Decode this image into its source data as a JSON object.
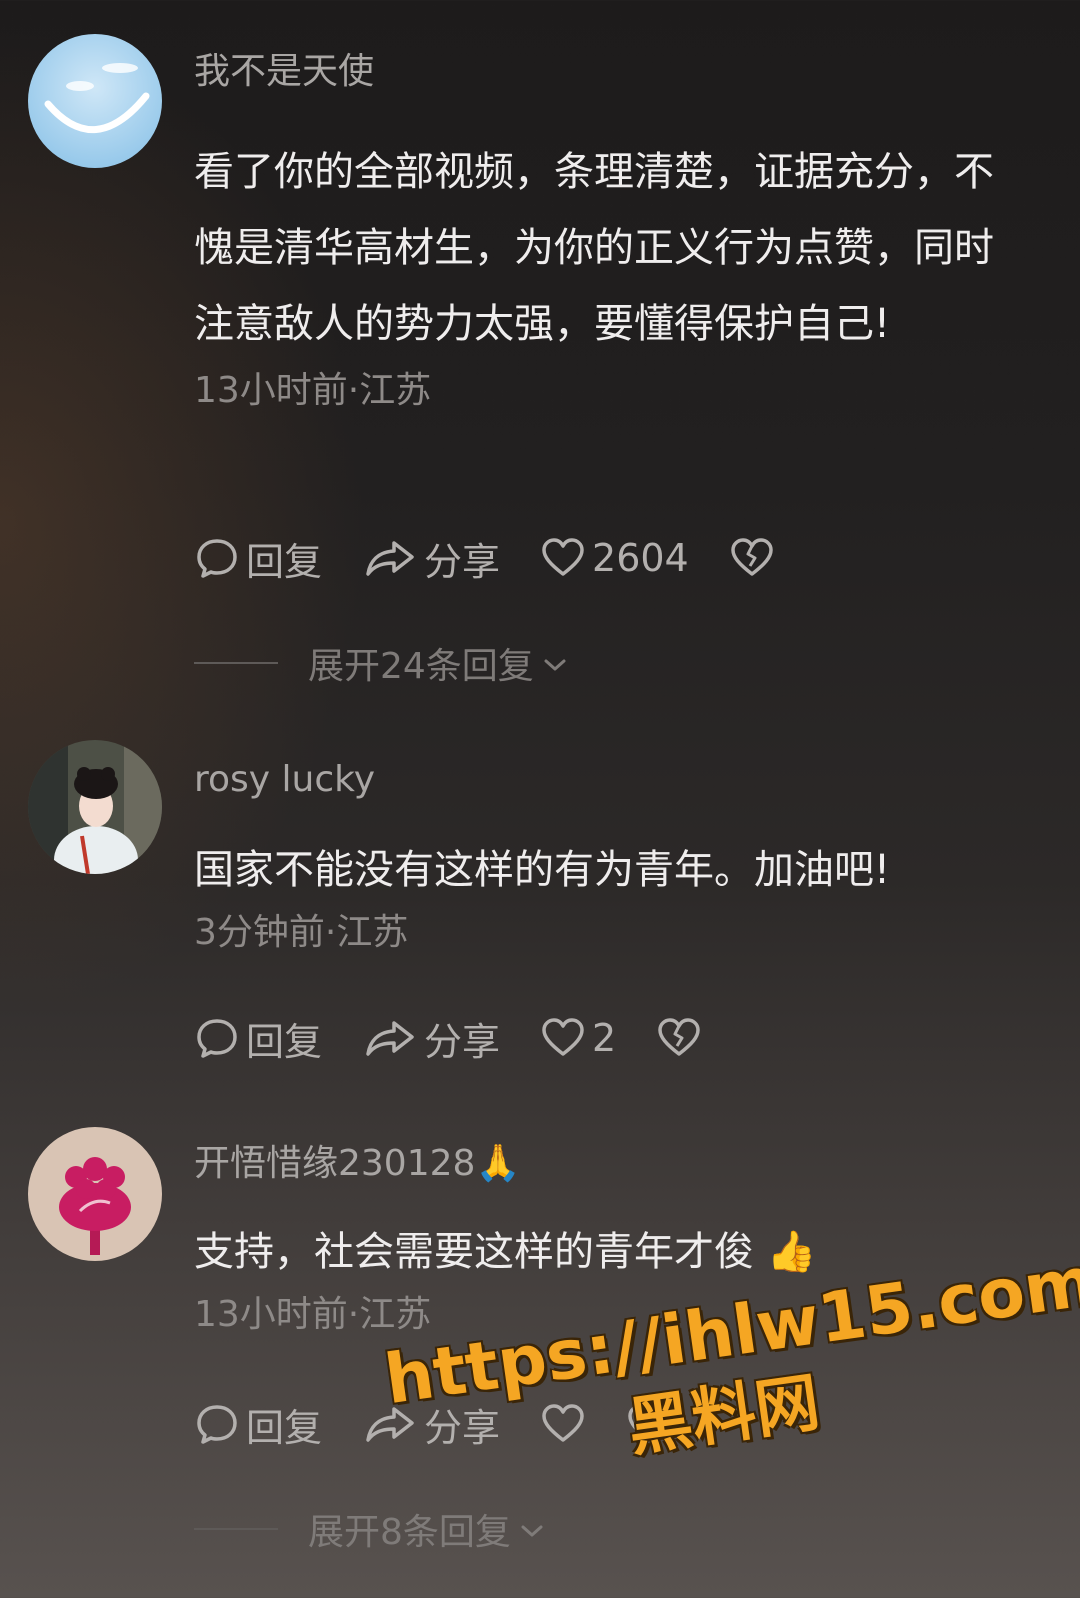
{
  "comments": [
    {
      "username": "我不是天使",
      "text": "看了你的全部视频，条理清楚，证据充分，不愧是清华高材生，为你的正义行为点赞，同时注意敌人的势力太强，要懂得保护自己!",
      "meta": "13小时前·江苏",
      "reply_label": "回复",
      "share_label": "分享",
      "likes": "2604",
      "expand_label": "展开24条回复"
    },
    {
      "username": "rosy lucky",
      "text": "国家不能没有这样的有为青年。加油吧!",
      "meta": "3分钟前·江苏",
      "reply_label": "回复",
      "share_label": "分享",
      "likes": "2"
    },
    {
      "username": "开悟惜缘230128",
      "username_emoji": "🙏",
      "text": "支持，社会需要这样的青年才俊",
      "text_emoji": "👍",
      "meta": "13小时前·江苏",
      "reply_label": "回复",
      "share_label": "分享",
      "expand_label": "展开8条回复"
    }
  ],
  "watermark": {
    "url": "https://ihlw15.com",
    "name": "黑料网"
  },
  "colors": {
    "accent_watermark": "#f5a623",
    "text_primary": "#efeded",
    "text_secondary": "#8e8a88"
  },
  "icons": [
    "comment-icon",
    "share-icon",
    "heart-icon",
    "broken-heart-icon",
    "chevron-down-icon"
  ]
}
